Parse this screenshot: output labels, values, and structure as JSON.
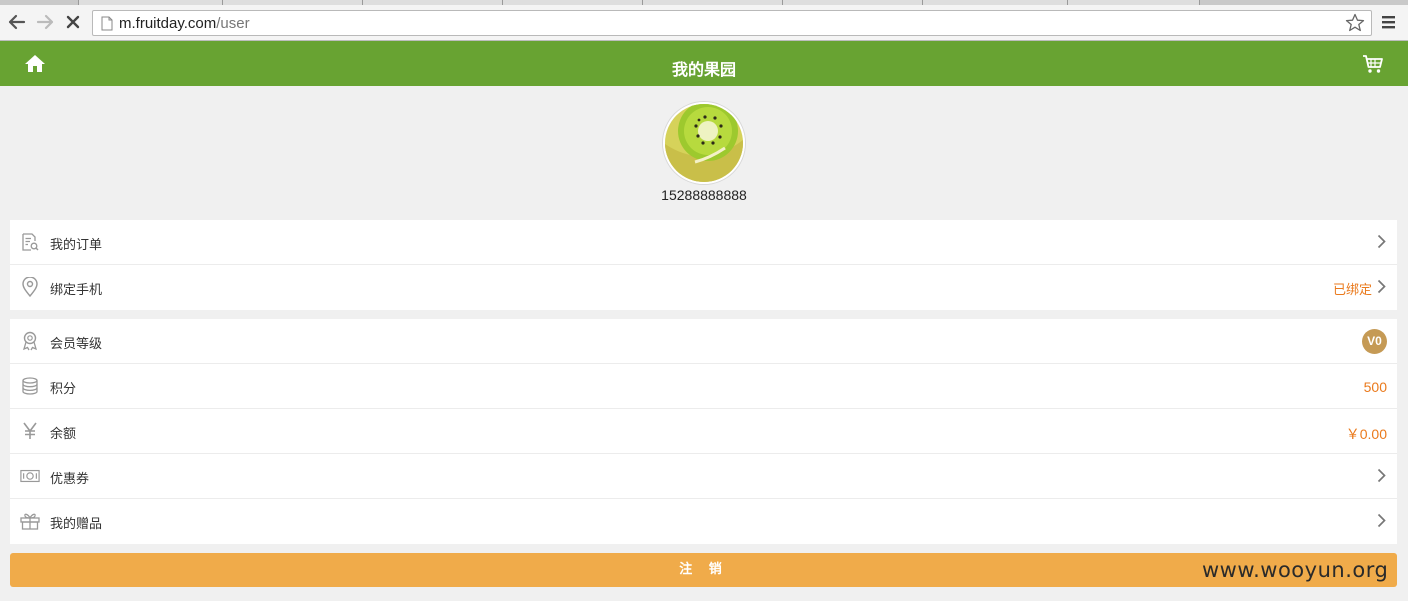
{
  "browser": {
    "url_host": "m.fruitday.com",
    "url_path": "/user"
  },
  "header": {
    "title": "我的果园"
  },
  "profile": {
    "phone": "15288888888"
  },
  "account_list": [
    {
      "label": "我的订单",
      "icon": "order-icon"
    },
    {
      "label": "绑定手机",
      "icon": "location-pin-icon",
      "status": "已绑定"
    }
  ],
  "assets_list": [
    {
      "label": "会员等级",
      "icon": "medal-icon",
      "level": "V0"
    },
    {
      "label": "积分",
      "icon": "coins-icon",
      "value": "500"
    },
    {
      "label": "余额",
      "icon": "yen-icon",
      "value": "￥0.00"
    },
    {
      "label": "优惠券",
      "icon": "coupon-icon"
    },
    {
      "label": "我的赠品",
      "icon": "gift-icon"
    }
  ],
  "logout_label": "注 销",
  "watermark": "www.wooyun.org",
  "colors": {
    "header_green": "#68a332",
    "accent_orange": "#ea7a1d",
    "logout_button": "#f0ab4a",
    "level_badge": "#c59a55"
  }
}
